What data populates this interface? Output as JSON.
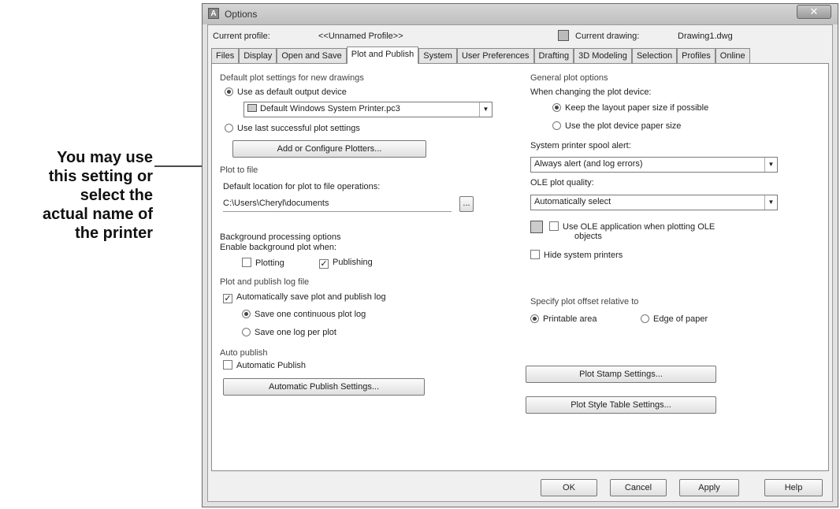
{
  "annotation": {
    "lines": [
      "You may use",
      "this setting or",
      "select the",
      "actual name of",
      "the printer"
    ]
  },
  "window": {
    "title": "Options",
    "app_icon": "A",
    "close_icon": "close-icon"
  },
  "header": {
    "current_profile_label": "Current profile:",
    "current_profile_value": "<<Unnamed Profile>>",
    "current_drawing_label": "Current drawing:",
    "current_drawing_value": "Drawing1.dwg"
  },
  "tabs": [
    {
      "label": "Files"
    },
    {
      "label": "Display"
    },
    {
      "label": "Open and Save"
    },
    {
      "label": "Plot and Publish",
      "active": true
    },
    {
      "label": "System"
    },
    {
      "label": "User Preferences"
    },
    {
      "label": "Drafting"
    },
    {
      "label": "3D Modeling"
    },
    {
      "label": "Selection"
    },
    {
      "label": "Profiles"
    },
    {
      "label": "Online"
    }
  ],
  "left": {
    "default_plot_title": "Default plot settings for new drawings",
    "use_default_device_label": "Use as default output device",
    "use_default_device_checked": true,
    "device_value": "Default Windows System Printer.pc3",
    "use_last_label": "Use last successful plot settings",
    "use_last_checked": false,
    "add_plotters_button": "Add or Configure Plotters...",
    "plot_to_file_title": "Plot to file",
    "default_location_label": "Default location for plot to file operations:",
    "default_location_value": "C:\\Users\\Cheryl\\documents",
    "browse_button": "...",
    "background_title": "Background processing options",
    "enable_background_label": "Enable background plot when:",
    "plotting_label": "Plotting",
    "plotting_checked": false,
    "publishing_label": "Publishing",
    "publishing_checked": true,
    "log_title": "Plot and publish log file",
    "auto_save_log_label": "Automatically save plot and publish log",
    "auto_save_log_checked": true,
    "continuous_log_label": "Save one continuous plot log",
    "continuous_log_checked": true,
    "log_per_plot_label": "Save one log per plot",
    "log_per_plot_checked": false,
    "auto_publish_title": "Auto publish",
    "automatic_publish_label": "Automatic Publish",
    "automatic_publish_checked": false,
    "auto_publish_settings_button": "Automatic Publish Settings..."
  },
  "right": {
    "general_title": "General plot options",
    "when_changing_label": "When changing the plot device:",
    "keep_layout_label": "Keep the layout paper size if possible",
    "keep_layout_checked": true,
    "use_device_paper_label": "Use the plot device paper size",
    "use_device_paper_checked": false,
    "spool_alert_label": "System printer spool alert:",
    "spool_alert_value": "Always alert (and log errors)",
    "ole_quality_label": "OLE plot quality:",
    "ole_quality_value": "Automatically select",
    "use_ole_label_line1": "Use OLE application when plotting OLE",
    "use_ole_label_line2": "objects",
    "use_ole_checked": false,
    "hide_printers_label": "Hide system printers",
    "hide_printers_checked": false,
    "offset_title": "Specify plot offset relative to",
    "printable_area_label": "Printable area",
    "printable_area_checked": true,
    "edge_of_paper_label": "Edge of paper",
    "edge_of_paper_checked": false,
    "plot_stamp_button": "Plot Stamp Settings...",
    "plot_style_button": "Plot Style Table Settings..."
  },
  "footer": {
    "ok": "OK",
    "cancel": "Cancel",
    "apply": "Apply",
    "help": "Help"
  }
}
